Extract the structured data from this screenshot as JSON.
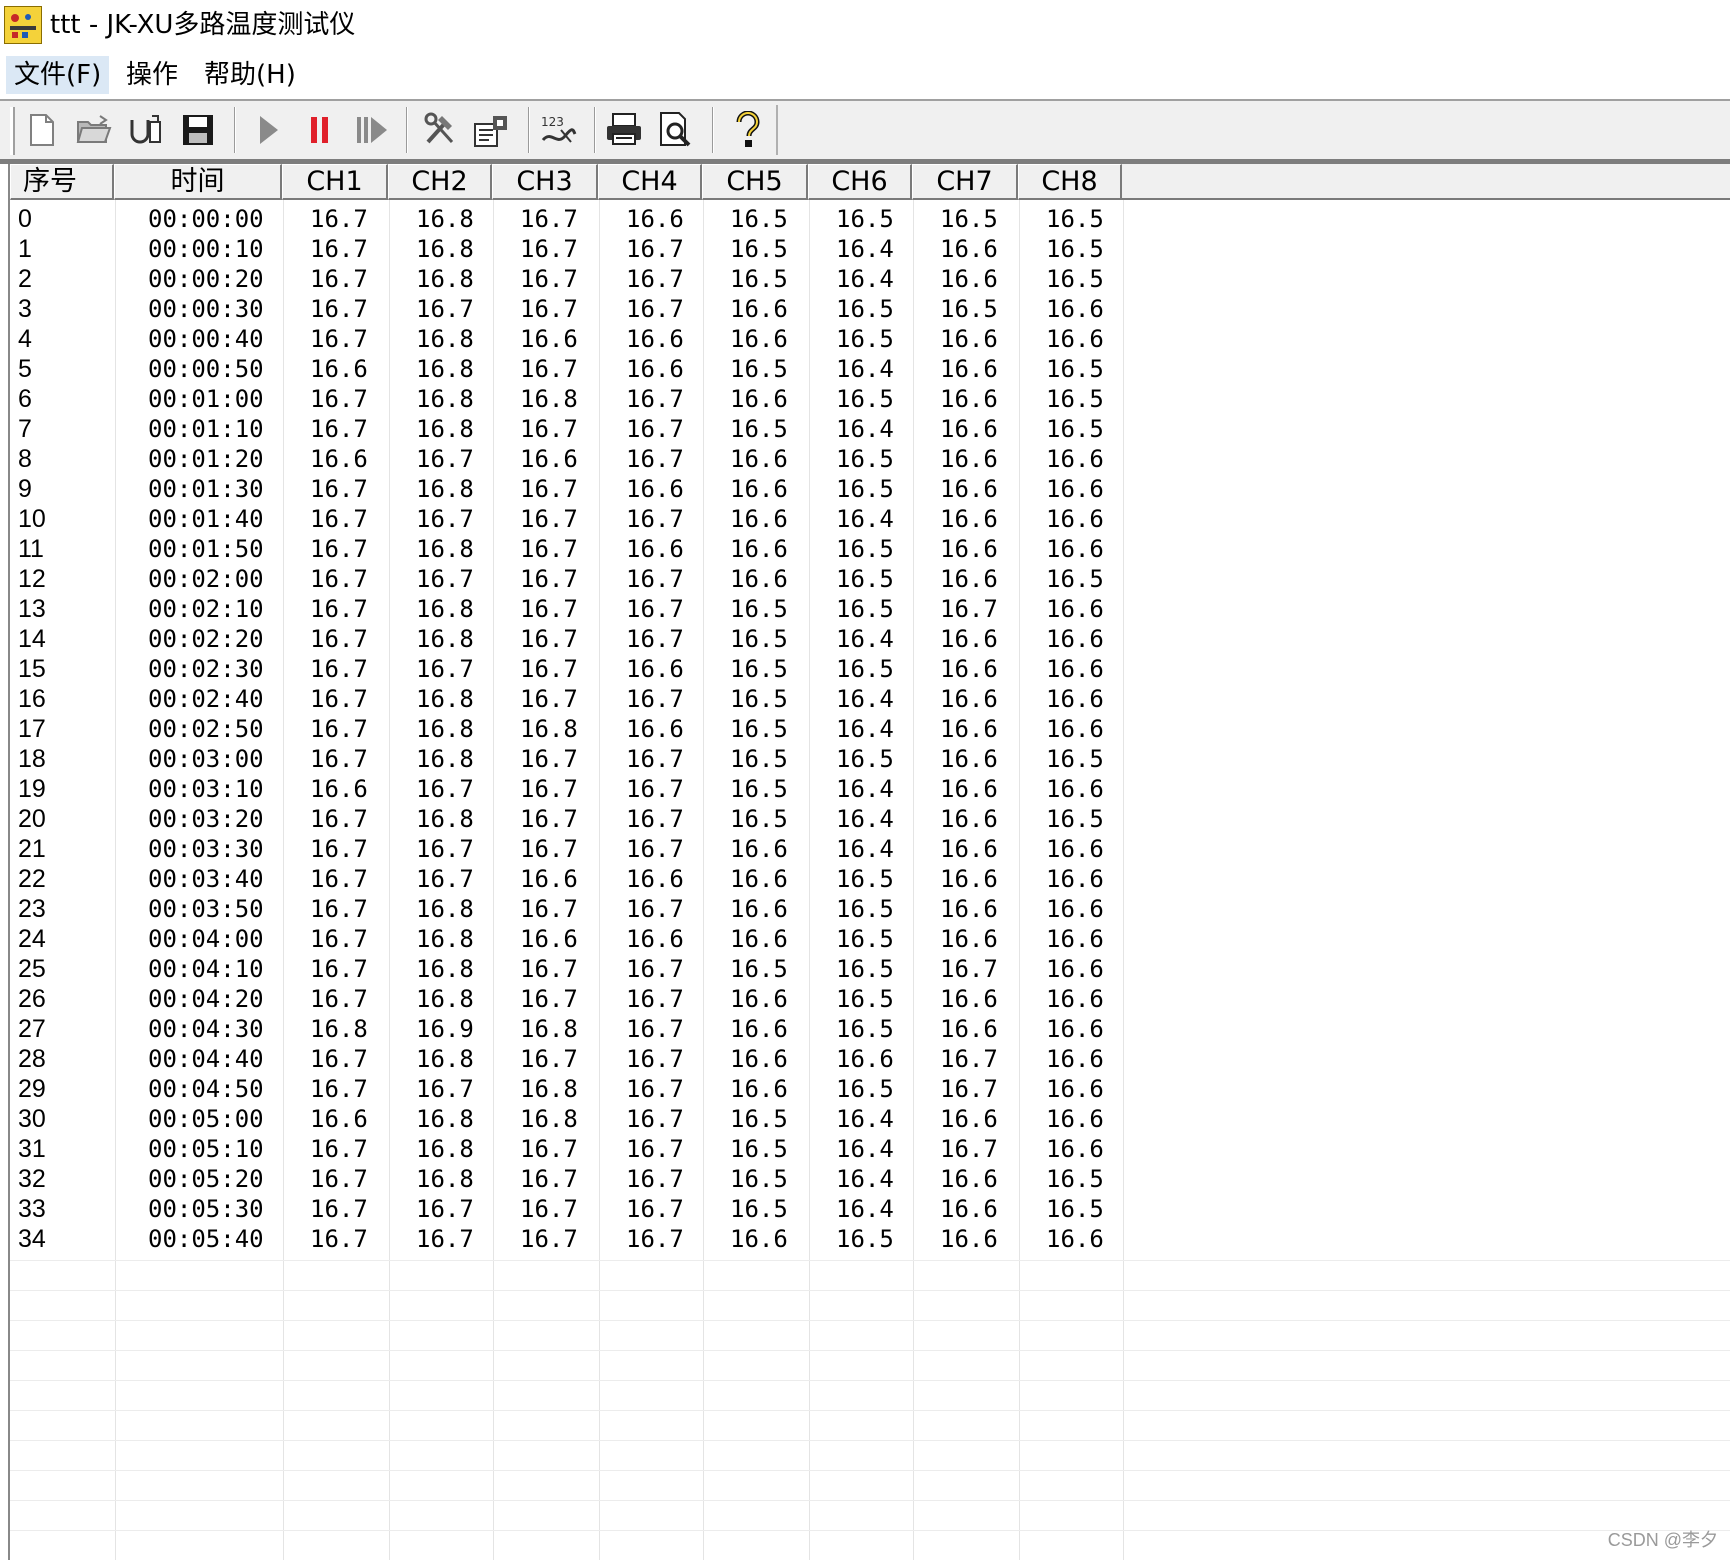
{
  "window": {
    "title": "ttt - JK-XU多路温度测试仪",
    "icon": "app-logo-icon"
  },
  "menu": [
    {
      "label": "文件(F)",
      "active": true
    },
    {
      "label": "操作",
      "active": false
    },
    {
      "label": "帮助(H)",
      "active": false
    }
  ],
  "toolbar": [
    {
      "icon": "new-file-icon"
    },
    {
      "icon": "open-folder-icon"
    },
    {
      "icon": "import-icon"
    },
    {
      "icon": "save-icon"
    },
    {
      "icon": "play-icon"
    },
    {
      "icon": "pause-icon"
    },
    {
      "icon": "step-forward-icon"
    },
    {
      "icon": "tools-icon"
    },
    {
      "icon": "settings-icon"
    },
    {
      "icon": "channel-config-icon"
    },
    {
      "icon": "print-icon"
    },
    {
      "icon": "print-preview-icon"
    },
    {
      "icon": "help-icon"
    }
  ],
  "colors": {
    "pause": "#e0202a",
    "play": "#707070",
    "accent_menu": "#dbe8f5"
  },
  "table": {
    "columns": [
      "序号",
      "时间",
      "CH1",
      "CH2",
      "CH3",
      "CH4",
      "CH5",
      "CH6",
      "CH7",
      "CH8"
    ],
    "rows": [
      [
        "0",
        "00:00:00",
        "16.7",
        "16.8",
        "16.7",
        "16.6",
        "16.5",
        "16.5",
        "16.5",
        "16.5"
      ],
      [
        "1",
        "00:00:10",
        "16.7",
        "16.8",
        "16.7",
        "16.7",
        "16.5",
        "16.4",
        "16.6",
        "16.5"
      ],
      [
        "2",
        "00:00:20",
        "16.7",
        "16.8",
        "16.7",
        "16.7",
        "16.5",
        "16.4",
        "16.6",
        "16.5"
      ],
      [
        "3",
        "00:00:30",
        "16.7",
        "16.7",
        "16.7",
        "16.7",
        "16.6",
        "16.5",
        "16.5",
        "16.6"
      ],
      [
        "4",
        "00:00:40",
        "16.7",
        "16.8",
        "16.6",
        "16.6",
        "16.6",
        "16.5",
        "16.6",
        "16.6"
      ],
      [
        "5",
        "00:00:50",
        "16.6",
        "16.8",
        "16.7",
        "16.6",
        "16.5",
        "16.4",
        "16.6",
        "16.5"
      ],
      [
        "6",
        "00:01:00",
        "16.7",
        "16.8",
        "16.8",
        "16.7",
        "16.6",
        "16.5",
        "16.6",
        "16.5"
      ],
      [
        "7",
        "00:01:10",
        "16.7",
        "16.8",
        "16.7",
        "16.7",
        "16.5",
        "16.4",
        "16.6",
        "16.5"
      ],
      [
        "8",
        "00:01:20",
        "16.6",
        "16.7",
        "16.6",
        "16.7",
        "16.6",
        "16.5",
        "16.6",
        "16.6"
      ],
      [
        "9",
        "00:01:30",
        "16.7",
        "16.8",
        "16.7",
        "16.6",
        "16.6",
        "16.5",
        "16.6",
        "16.6"
      ],
      [
        "10",
        "00:01:40",
        "16.7",
        "16.7",
        "16.7",
        "16.7",
        "16.6",
        "16.4",
        "16.6",
        "16.6"
      ],
      [
        "11",
        "00:01:50",
        "16.7",
        "16.8",
        "16.7",
        "16.6",
        "16.6",
        "16.5",
        "16.6",
        "16.6"
      ],
      [
        "12",
        "00:02:00",
        "16.7",
        "16.7",
        "16.7",
        "16.7",
        "16.6",
        "16.5",
        "16.6",
        "16.5"
      ],
      [
        "13",
        "00:02:10",
        "16.7",
        "16.8",
        "16.7",
        "16.7",
        "16.5",
        "16.5",
        "16.7",
        "16.6"
      ],
      [
        "14",
        "00:02:20",
        "16.7",
        "16.8",
        "16.7",
        "16.7",
        "16.5",
        "16.4",
        "16.6",
        "16.6"
      ],
      [
        "15",
        "00:02:30",
        "16.7",
        "16.7",
        "16.7",
        "16.6",
        "16.5",
        "16.5",
        "16.6",
        "16.6"
      ],
      [
        "16",
        "00:02:40",
        "16.7",
        "16.8",
        "16.7",
        "16.7",
        "16.5",
        "16.4",
        "16.6",
        "16.6"
      ],
      [
        "17",
        "00:02:50",
        "16.7",
        "16.8",
        "16.8",
        "16.6",
        "16.5",
        "16.4",
        "16.6",
        "16.6"
      ],
      [
        "18",
        "00:03:00",
        "16.7",
        "16.8",
        "16.7",
        "16.7",
        "16.5",
        "16.5",
        "16.6",
        "16.5"
      ],
      [
        "19",
        "00:03:10",
        "16.6",
        "16.7",
        "16.7",
        "16.7",
        "16.5",
        "16.4",
        "16.6",
        "16.6"
      ],
      [
        "20",
        "00:03:20",
        "16.7",
        "16.8",
        "16.7",
        "16.7",
        "16.5",
        "16.4",
        "16.6",
        "16.5"
      ],
      [
        "21",
        "00:03:30",
        "16.7",
        "16.7",
        "16.7",
        "16.7",
        "16.6",
        "16.4",
        "16.6",
        "16.6"
      ],
      [
        "22",
        "00:03:40",
        "16.7",
        "16.7",
        "16.6",
        "16.6",
        "16.6",
        "16.5",
        "16.6",
        "16.6"
      ],
      [
        "23",
        "00:03:50",
        "16.7",
        "16.8",
        "16.7",
        "16.7",
        "16.6",
        "16.5",
        "16.6",
        "16.6"
      ],
      [
        "24",
        "00:04:00",
        "16.7",
        "16.8",
        "16.6",
        "16.6",
        "16.6",
        "16.5",
        "16.6",
        "16.6"
      ],
      [
        "25",
        "00:04:10",
        "16.7",
        "16.8",
        "16.7",
        "16.7",
        "16.5",
        "16.5",
        "16.7",
        "16.6"
      ],
      [
        "26",
        "00:04:20",
        "16.7",
        "16.8",
        "16.7",
        "16.7",
        "16.6",
        "16.5",
        "16.6",
        "16.6"
      ],
      [
        "27",
        "00:04:30",
        "16.8",
        "16.9",
        "16.8",
        "16.7",
        "16.6",
        "16.5",
        "16.6",
        "16.6"
      ],
      [
        "28",
        "00:04:40",
        "16.7",
        "16.8",
        "16.7",
        "16.7",
        "16.6",
        "16.6",
        "16.7",
        "16.6"
      ],
      [
        "29",
        "00:04:50",
        "16.7",
        "16.7",
        "16.8",
        "16.7",
        "16.6",
        "16.5",
        "16.7",
        "16.6"
      ],
      [
        "30",
        "00:05:00",
        "16.6",
        "16.8",
        "16.8",
        "16.7",
        "16.5",
        "16.4",
        "16.6",
        "16.6"
      ],
      [
        "31",
        "00:05:10",
        "16.7",
        "16.8",
        "16.7",
        "16.7",
        "16.5",
        "16.4",
        "16.7",
        "16.6"
      ],
      [
        "32",
        "00:05:20",
        "16.7",
        "16.8",
        "16.7",
        "16.7",
        "16.5",
        "16.4",
        "16.6",
        "16.5"
      ],
      [
        "33",
        "00:05:30",
        "16.7",
        "16.7",
        "16.7",
        "16.7",
        "16.5",
        "16.4",
        "16.6",
        "16.5"
      ],
      [
        "34",
        "00:05:40",
        "16.7",
        "16.7",
        "16.7",
        "16.7",
        "16.6",
        "16.5",
        "16.6",
        "16.6"
      ]
    ]
  },
  "watermark": "CSDN @李夕"
}
